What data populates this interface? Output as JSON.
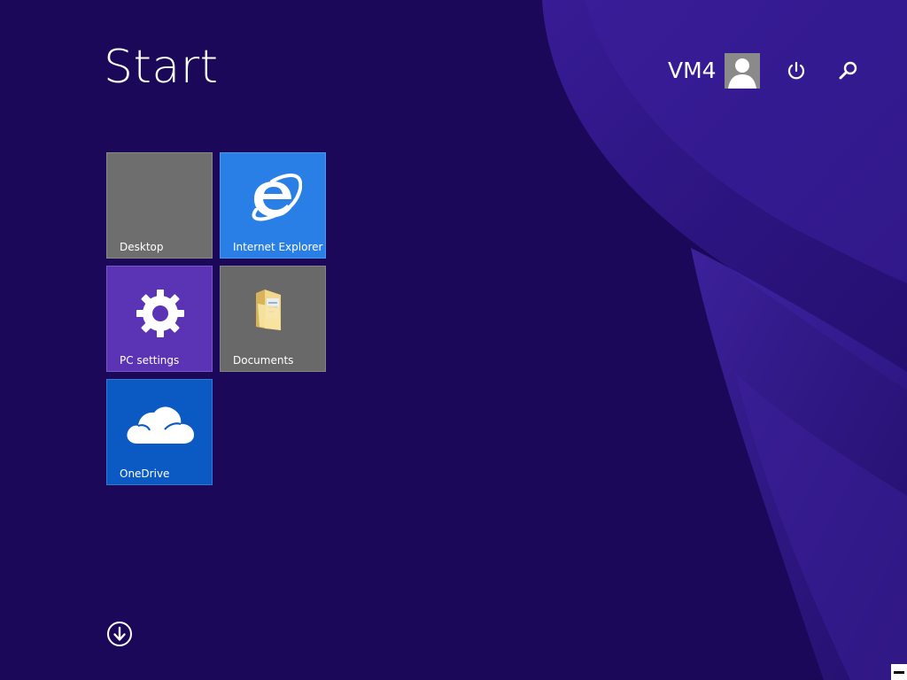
{
  "header": {
    "title": "Start",
    "user_name": "VM4"
  },
  "icons": {
    "avatar": "user-avatar-icon",
    "power": "power-icon",
    "search": "search-icon",
    "all_apps": "arrow-down-circle-icon"
  },
  "tiles": [
    {
      "label": "Desktop",
      "color": "#6e6e6e",
      "icon": "none"
    },
    {
      "label": "Internet Explorer",
      "color": "#2a7fe6",
      "icon": "internet-explorer-icon"
    },
    {
      "label": "PC settings",
      "color": "#5b34b5",
      "icon": "gear-icon"
    },
    {
      "label": "Documents",
      "color": "#696969",
      "icon": "folder-icon"
    },
    {
      "label": "OneDrive",
      "color": "#0b5ac4",
      "icon": "cloud-icon"
    }
  ],
  "colors": {
    "background": "#1c0858",
    "swirl": "#3a1f9a"
  }
}
